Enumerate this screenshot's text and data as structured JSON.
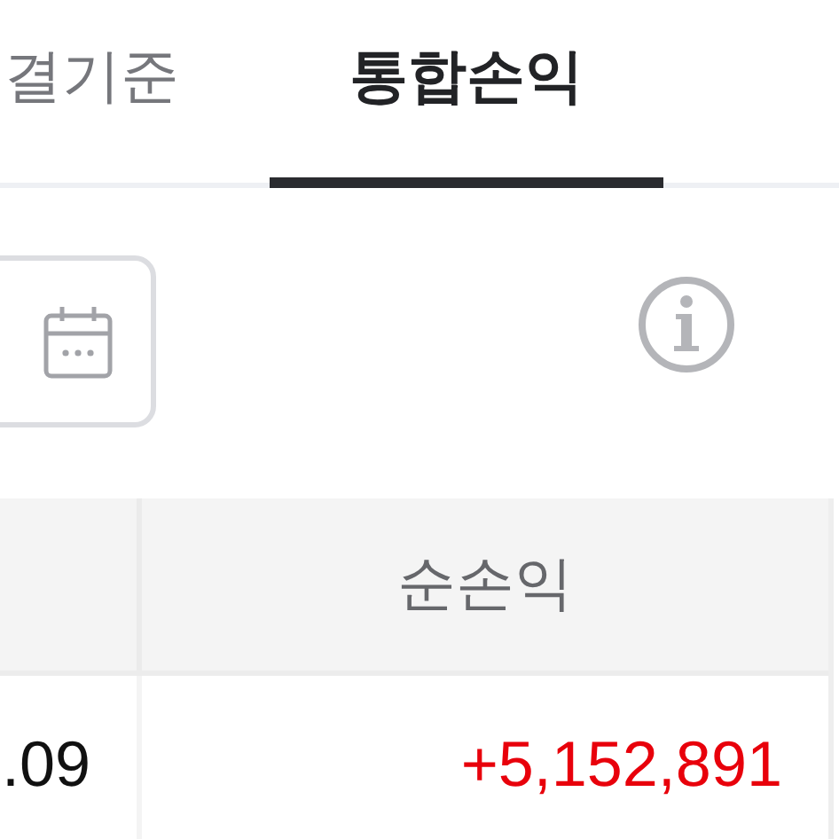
{
  "tabs": [
    {
      "label": "결기준",
      "selected": false
    },
    {
      "label": "통합손익",
      "selected": true
    }
  ],
  "table": {
    "columns": [
      "순손익"
    ],
    "rows": [
      {
        "column_1": ".09",
        "net_profit": "+5,152,891",
        "color": "#e8000b"
      }
    ]
  }
}
